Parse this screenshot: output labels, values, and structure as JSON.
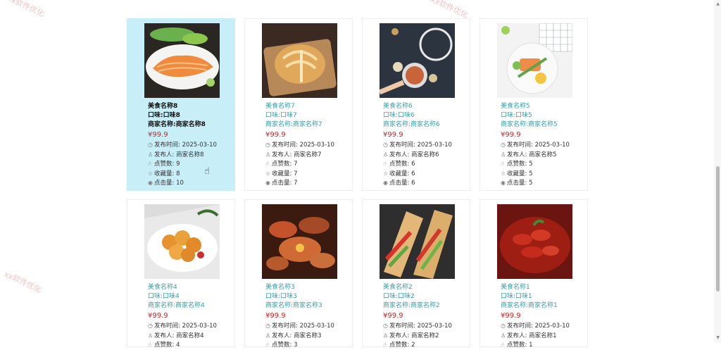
{
  "watermark": "xx软件优化",
  "cards": [
    {
      "name": "美食名称8",
      "taste": "口味:口味8",
      "merchant": "商家名称:商家名称8",
      "price": "¥99.9",
      "time": "发布时间:  2025-03-10",
      "publisher": "发布人:  商家名称8",
      "likes": "点赞数:  9",
      "favorites": "收藏量:  8",
      "clicks": "点击量:  10",
      "image": "salmon-sashimi-plate"
    },
    {
      "name": "美食名称7",
      "taste": "口味:口味7",
      "merchant": "商家名称:商家名称7",
      "price": "¥99.9",
      "time": "发布时间:  2025-03-10",
      "publisher": "发布人:  商家名称7",
      "likes": "点赞数:  7",
      "favorites": "收藏量:  7",
      "clicks": "点击量:  7",
      "image": "bread-loaf-on-board"
    },
    {
      "name": "美食名称6",
      "taste": "口味:口味6",
      "merchant": "商家名称:商家名称6",
      "price": "¥99.9",
      "time": "发布时间:  2025-03-10",
      "publisher": "发布人:  商家名称6",
      "likes": "点赞数:  6",
      "favorites": "收藏量:  6",
      "clicks": "点击量:  6",
      "image": "shrimp-bowl-dark-table"
    },
    {
      "name": "美食名称5",
      "taste": "口味:口味5",
      "merchant": "商家名称:商家名称5",
      "price": "¥99.9",
      "time": "发布时间:  2025-03-10",
      "publisher": "发布人:  商家名称5",
      "likes": "点赞数:  5",
      "favorites": "收藏量:  5",
      "clicks": "点击量:  5",
      "image": "salmon-salad-bowl"
    },
    {
      "name": "美食名称4",
      "taste": "口味:口味4",
      "merchant": "商家名称:商家名称4",
      "price": "¥99.9",
      "time": "发布时间:  2025-03-10",
      "publisher": "发布人:  商家名称4",
      "likes": "点赞数:  4",
      "favorites": "",
      "clicks": "",
      "image": "fried-chicken-plate"
    },
    {
      "name": "美食名称3",
      "taste": "口味:口味3",
      "merchant": "商家名称:商家名称3",
      "price": "¥99.9",
      "time": "发布时间:  2025-03-10",
      "publisher": "发布人:  商家名称3",
      "likes": "点赞数:  3",
      "favorites": "",
      "clicks": "",
      "image": "feast-table"
    },
    {
      "name": "美食名称2",
      "taste": "口味:口味2",
      "merchant": "商家名称:商家名称2",
      "price": "¥99.9",
      "time": "发布时间:  2025-03-10",
      "publisher": "发布人:  商家名称2",
      "likes": "点赞数:  2",
      "favorites": "",
      "clicks": "",
      "image": "burrito-wraps"
    },
    {
      "name": "美食名称1",
      "taste": "口味:口味1",
      "merchant": "商家名称:商家名称1",
      "price": "¥99.9",
      "time": "发布时间:  2025-03-10",
      "publisher": "发布人:  商家名称1",
      "likes": "点赞数:  1",
      "favorites": "",
      "clicks": "",
      "image": "crayfish-plate"
    }
  ],
  "icons": {
    "time": "clock-icon",
    "publisher": "user-icon",
    "likes": "thumb-up-icon",
    "favorites": "star-icon",
    "clicks": "eye-icon"
  },
  "colors": {
    "active_card": "#c8eef8",
    "link_text": "#3a9fa9",
    "price": "#d32222"
  }
}
